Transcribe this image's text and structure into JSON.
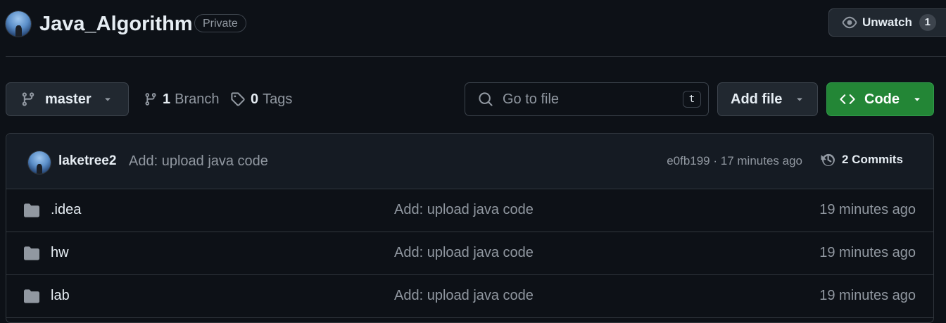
{
  "repo": {
    "name": "Java_Algorithm",
    "visibility": "Private",
    "watch_label": "Unwatch",
    "watch_count": "1"
  },
  "toolbar": {
    "branch": "master",
    "branch_count": "1",
    "branch_label": "Branch",
    "tag_count": "0",
    "tag_label": "Tags",
    "search_placeholder": "Go to file",
    "search_shortcut": "t",
    "add_file_label": "Add file",
    "code_label": "Code"
  },
  "latest_commit": {
    "author": "laketree2",
    "message": "Add: upload java code",
    "meta": "e0fb199 · 17 minutes ago",
    "commits_label": "2 Commits"
  },
  "files": [
    {
      "name": ".idea",
      "message": "Add: upload java code",
      "time": "19 minutes ago"
    },
    {
      "name": "hw",
      "message": "Add: upload java code",
      "time": "19 minutes ago"
    },
    {
      "name": "lab",
      "message": "Add: upload java code",
      "time": "19 minutes ago"
    }
  ],
  "icons": {
    "watch": "eye-icon",
    "branch": "git-branch-icon",
    "tag": "tag-icon",
    "search": "search-icon",
    "code": "code-icon",
    "history": "history-icon",
    "folder": "folder-icon",
    "caret": "triangle-down-icon"
  },
  "colors": {
    "background": "#0d1117",
    "code_button": "#238636",
    "muted_text": "#9198a1",
    "folder": "#9198a1"
  }
}
